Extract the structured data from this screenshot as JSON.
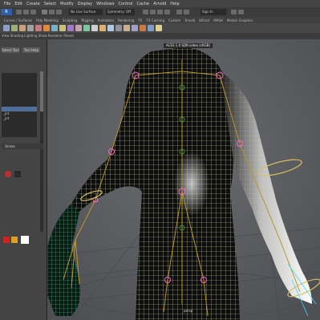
{
  "menu": [
    "File",
    "Edit",
    "Create",
    "Select",
    "Modify",
    "Display",
    "Windows",
    "Control",
    "Cache",
    "Arnold",
    "Help"
  ],
  "statusline": {
    "mode_label": "R",
    "field_a": "No Live Surface",
    "field_b": "Symmetry: Off",
    "field_c": "Sign In"
  },
  "shelf_tabs": [
    "Curves / Surfaces",
    "Poly Modeling",
    "Sculpting",
    "Rigging",
    "Animation",
    "Rendering",
    "FX",
    "FX Caching",
    "Custom",
    "Arnold",
    "Bifrost",
    "MASH",
    "Motion Graphics"
  ],
  "viewport": {
    "hud": "ACES 1.0 SDR-video (sRGB)",
    "camera_label": "persp"
  },
  "left_panel": {
    "btn_a": "Select Tool",
    "btn_b": "Tool Help",
    "list": [
      "",
      "",
      "",
      "",
      "",
      "",
      "",
      "",
      "_jnt",
      "_jnt",
      "",
      ""
    ],
    "section": "Stroke"
  },
  "colors": {
    "mesh": "#e0f08a",
    "mesh_cool": "#3fd6a0",
    "joint": "#ff66cc",
    "bone": "#9a7a1a",
    "accent": "#2d5fa8"
  }
}
